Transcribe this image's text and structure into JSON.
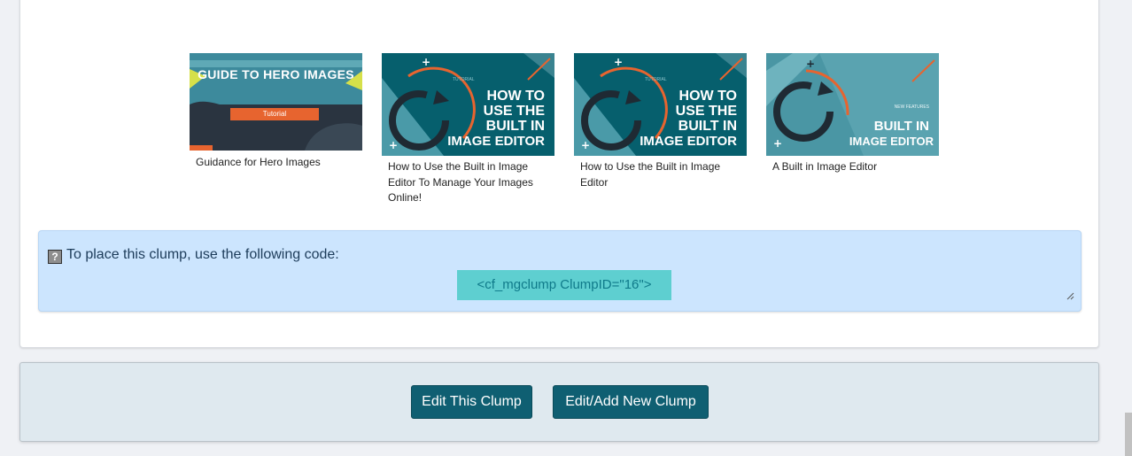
{
  "gallery": {
    "items": [
      {
        "caption": "Guidance for Hero Images",
        "thumb_title": "GUIDE TO HERO IMAGES",
        "thumb_button": "Tutorial"
      },
      {
        "caption": "How to Use the Built in Image Editor To Manage Your Images Online!",
        "thumb_tag": "TUTORIAL",
        "thumb_lines": [
          "HOW TO",
          "USE THE",
          "BUILT IN",
          "IMAGE EDITOR"
        ]
      },
      {
        "caption": "How to Use the Built in Image Editor",
        "thumb_tag": "TUTORIAL",
        "thumb_lines": [
          "HOW TO",
          "USE THE",
          "BUILT IN",
          "IMAGE EDITOR"
        ]
      },
      {
        "caption": "A Built in Image Editor",
        "thumb_tag": "NEW FEATURES",
        "thumb_lines": [
          "BUILT IN",
          "IMAGE EDITOR"
        ]
      }
    ]
  },
  "code_box": {
    "help_icon": "?",
    "prompt": "To place this clump, use the following code:",
    "snippet": "<cf_mgclump ClumpID=\"16\">"
  },
  "footer": {
    "edit_label": "Edit This Clump",
    "add_label": "Edit/Add New Clump"
  },
  "colors": {
    "button": "#0f5f72",
    "code_bg": "#cce5fe",
    "snippet_bg": "#5ecfd0",
    "thumb_teal": "#065f6d",
    "accent_orange": "#e7642f"
  }
}
